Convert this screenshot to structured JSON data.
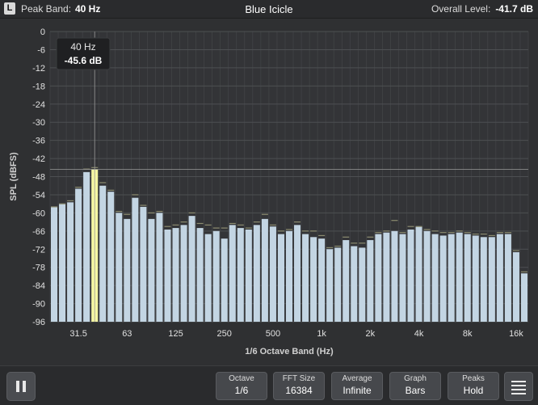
{
  "topbar": {
    "channel": "L",
    "peak_label": "Peak Band:",
    "peak_value": "40 Hz",
    "title": "Blue Icicle",
    "overall_label": "Overall Level:",
    "overall_value": "-41.7 dB"
  },
  "tooltip": {
    "freq": "40 Hz",
    "level": "-45.6 dB"
  },
  "chart_data": {
    "type": "bar",
    "xlabel": "1/6 Octave Band (Hz)",
    "ylabel": "SPL (dBFS)",
    "ylim": [
      -96,
      0
    ],
    "yticks": [
      "0",
      "-6",
      "-12",
      "-18",
      "-24",
      "-30",
      "-36",
      "-42",
      "-48",
      "-54",
      "-60",
      "-66",
      "-72",
      "-78",
      "-84",
      "-90",
      "-96"
    ],
    "xticks": [
      {
        "label": "31.5",
        "band": 3
      },
      {
        "label": "63",
        "band": 9
      },
      {
        "label": "125",
        "band": 15
      },
      {
        "label": "250",
        "band": 21
      },
      {
        "label": "500",
        "band": 27
      },
      {
        "label": "1k",
        "band": 33
      },
      {
        "label": "2k",
        "band": 39
      },
      {
        "label": "4k",
        "band": 45
      },
      {
        "label": "8k",
        "band": 51
      },
      {
        "label": "16k",
        "band": 57
      }
    ],
    "highlight_index": 5,
    "peak_reference_db": -45.6,
    "values": [
      -58,
      -57,
      -56.5,
      -52,
      -46.5,
      -45.6,
      -51,
      -53,
      -60,
      -62,
      -55,
      -58,
      -62,
      -60,
      -65.5,
      -65,
      -64,
      -61,
      -65,
      -67,
      -66,
      -68.5,
      -64,
      -65,
      -65.5,
      -64,
      -62,
      -64.5,
      -67,
      -66,
      -64,
      -67,
      -68,
      -68.5,
      -72,
      -71.5,
      -69,
      -71,
      -71.5,
      -69,
      -67,
      -66.5,
      -66,
      -67,
      -65.5,
      -64.5,
      -66,
      -67,
      -67.5,
      -67,
      -66.5,
      -67,
      -67.5,
      -68,
      -68,
      -67,
      -67,
      -73,
      -80
    ],
    "peaks": [
      -58,
      -57,
      -56,
      -51.5,
      -45.5,
      -45,
      -50,
      -52.5,
      -59.5,
      -60.5,
      -54,
      -57.5,
      -60,
      -59.5,
      -64.5,
      -64,
      -63,
      -60,
      -63.5,
      -64,
      -65,
      -65,
      -63.5,
      -64,
      -65,
      -63,
      -60.5,
      -64,
      -66,
      -65.5,
      -63,
      -66,
      -66,
      -67.5,
      -71.5,
      -71,
      -68,
      -70,
      -70,
      -68,
      -66.5,
      -66,
      -62.5,
      -66.5,
      -64.5,
      -64.5,
      -65.5,
      -66,
      -66.5,
      -66.5,
      -66,
      -66.5,
      -67,
      -67,
      -67.5,
      -66.5,
      -66.5,
      -72.5,
      -79.5
    ]
  },
  "controls": [
    {
      "label": "Octave",
      "value": "1/6"
    },
    {
      "label": "FFT Size",
      "value": "16384"
    },
    {
      "label": "Average",
      "value": "Infinite"
    },
    {
      "label": "Graph",
      "value": "Bars"
    },
    {
      "label": "Peaks",
      "value": "Hold"
    }
  ],
  "colors": {
    "bar": "#c3d5e3",
    "highlight": "#f6f7a3",
    "grid": "#46484b",
    "background": "#2f3032",
    "peak_line": "#8c8c70"
  },
  "icons": {
    "pause": "pause-icon",
    "menu": "menu-icon"
  }
}
